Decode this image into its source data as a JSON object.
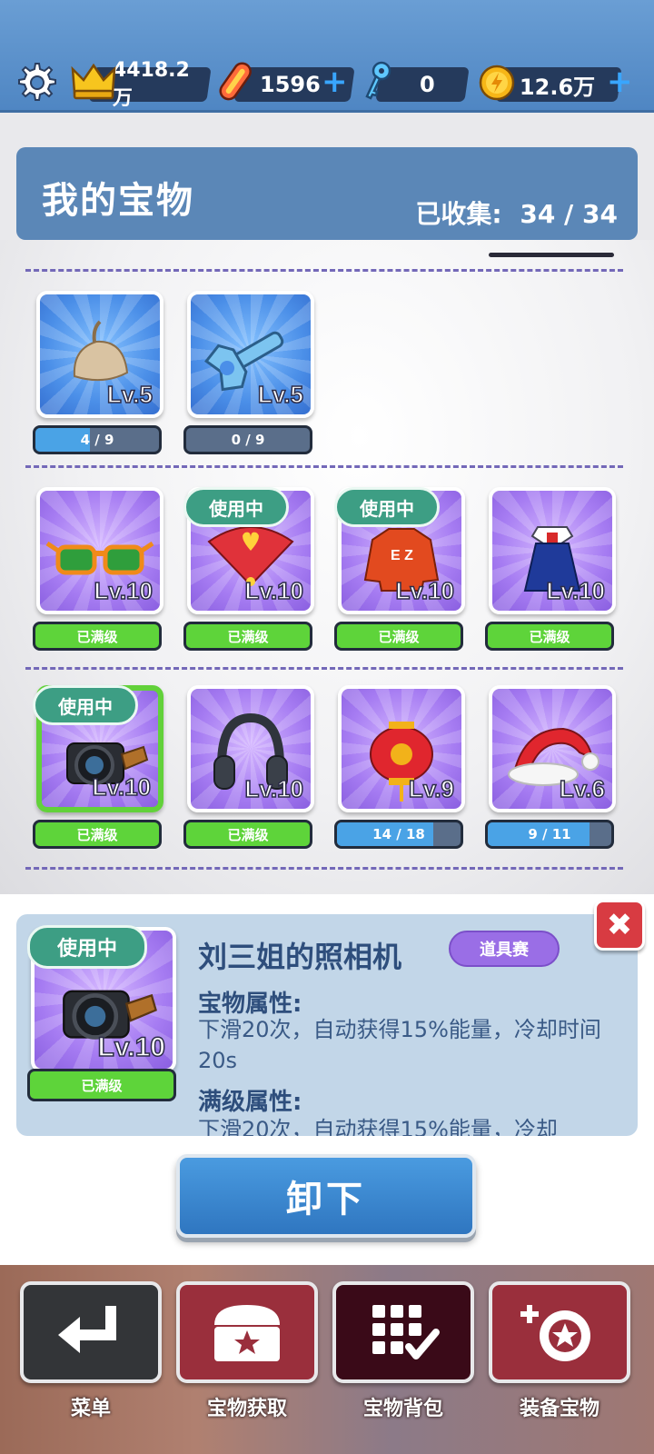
{
  "topbar": {
    "crown_value": "4418.2万",
    "board_value": "1596",
    "key_value": "0",
    "coin_value": "12.6万",
    "icons": [
      "gear-icon",
      "crown-icon",
      "skateboard-icon",
      "key-icon",
      "coin-icon",
      "plus-icon"
    ]
  },
  "header": {
    "title": "我的宝物",
    "collected_label": "已收集:",
    "collected_value": "34 / 34"
  },
  "rows": [
    {
      "items": [
        {
          "name": "hat-item",
          "level": "Lv.5",
          "progress": "4 / 9",
          "fill": 0.44,
          "frame": "blue",
          "in_use": false,
          "max": false,
          "selected": false
        },
        {
          "name": "wrench-item",
          "level": "Lv.5",
          "progress": "0 / 9",
          "fill": 0,
          "frame": "blue",
          "in_use": false,
          "max": false,
          "selected": false
        }
      ]
    },
    {
      "items": [
        {
          "name": "sunglasses-item",
          "level": "Lv.10",
          "progress": "已满级",
          "fill": 1,
          "frame": "purple",
          "in_use": false,
          "max": true,
          "selected": false
        },
        {
          "name": "fan-item",
          "level": "Lv.10",
          "progress": "已满级",
          "fill": 1,
          "frame": "purple",
          "in_use": true,
          "max": true,
          "selected": false
        },
        {
          "name": "jacket-item",
          "level": "Lv.10",
          "progress": "已满级",
          "fill": 1,
          "frame": "purple",
          "in_use": true,
          "max": true,
          "selected": false
        },
        {
          "name": "uniform-item",
          "level": "Lv.10",
          "progress": "已满级",
          "fill": 1,
          "frame": "purple",
          "in_use": false,
          "max": true,
          "selected": false
        }
      ]
    },
    {
      "items": [
        {
          "name": "camera-item",
          "level": "Lv.10",
          "progress": "已满级",
          "fill": 1,
          "frame": "purple",
          "in_use": true,
          "max": true,
          "selected": true
        },
        {
          "name": "headphones-item",
          "level": "Lv.10",
          "progress": "已满级",
          "fill": 1,
          "frame": "purple",
          "in_use": false,
          "max": true,
          "selected": false
        },
        {
          "name": "lantern-item",
          "level": "Lv.9",
          "progress": "14 / 18",
          "fill": 0.78,
          "frame": "purple",
          "in_use": false,
          "max": false,
          "selected": false
        },
        {
          "name": "santa-hat-item",
          "level": "Lv.6",
          "progress": "9 / 11",
          "fill": 0.82,
          "frame": "purple",
          "in_use": false,
          "max": false,
          "selected": false
        }
      ]
    }
  ],
  "in_use_label": "使用中",
  "detail": {
    "badge": "使用中",
    "level": "Lv.10",
    "status": "已满级",
    "name": "刘三姐的照相机",
    "tag": "道具赛",
    "attr_title": "宝物属性:",
    "attr_text": "下滑20次，自动获得15%能量，冷却时间20s",
    "max_title": "满级属性:",
    "max_text": "下滑20次，自动获得15%能量，冷却"
  },
  "close_label": "✖",
  "unequip_label": "卸下",
  "nav": [
    {
      "id": "menu",
      "label": "菜单",
      "icon": "back-arrow-icon"
    },
    {
      "id": "acquire",
      "label": "宝物获取",
      "icon": "chest-icon"
    },
    {
      "id": "bag",
      "label": "宝物背包",
      "icon": "grid-check-icon"
    },
    {
      "id": "equip",
      "label": "装备宝物",
      "icon": "equip-badge-icon"
    }
  ]
}
